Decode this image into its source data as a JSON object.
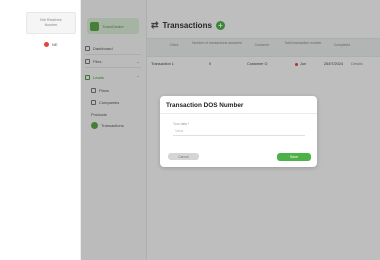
{
  "left_panel": {
    "card_line1": "Brb Relatives",
    "card_line2": "Number",
    "lang_label": "NE"
  },
  "sidebar": {
    "logo_text": "TransDealer",
    "items": [
      {
        "label": "Dashboard"
      },
      {
        "label": "Files"
      },
      {
        "label": "Leads"
      }
    ],
    "subitems": [
      {
        "label": "Plans"
      },
      {
        "label": "Companies"
      },
      {
        "label": "Products"
      },
      {
        "label": "Transactions"
      }
    ]
  },
  "page": {
    "title": "Transactions"
  },
  "table": {
    "headers": [
      "Client",
      "Number of transactions accepted",
      "Customer",
      "Total transaction number",
      "Completed"
    ],
    "row": [
      "Transaction 1",
      "0",
      "Customer O",
      "Jun",
      "26/07/2024",
      "Details"
    ]
  },
  "modal": {
    "title": "Transaction DOS Number",
    "field_label": "Your data *",
    "field_placeholder": "Value",
    "cancel_label": "Cancel",
    "save_label": "Save"
  },
  "colors": {
    "accent": "#4cb247",
    "status_dot": "#e2453c"
  }
}
